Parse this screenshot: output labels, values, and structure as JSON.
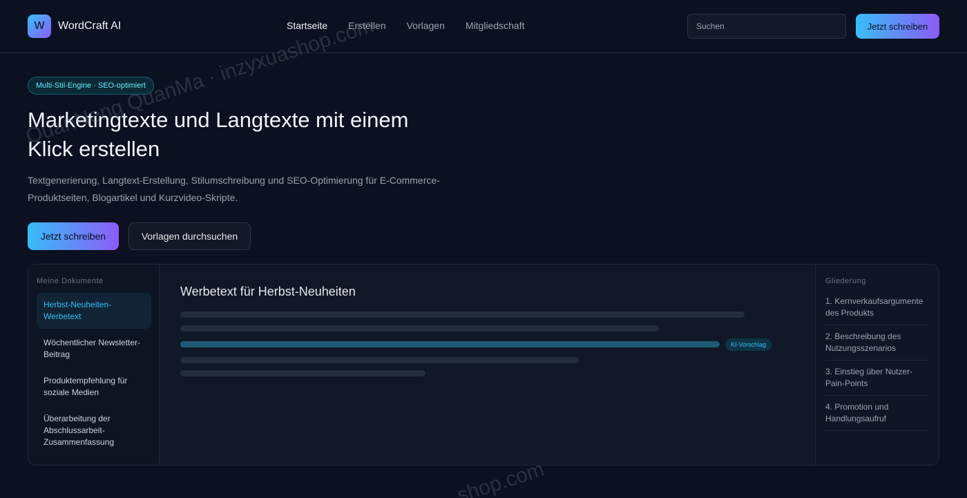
{
  "header": {
    "logo_letter": "W",
    "brand": "WordCraft AI",
    "nav": [
      "Startseite",
      "Erstellen",
      "Vorlagen",
      "Mitgliedschaft"
    ],
    "active_nav": "Startseite",
    "search_placeholder": "Suchen",
    "cta_label": "Jetzt schreiben"
  },
  "hero": {
    "badge": "Multi-Stil-Engine · SEO-optimiert",
    "title": "Marketingtexte und Langtexte mit einem Klick erstellen",
    "subtitle": "Textgenerierung, Langtext-Erstellung, Stilumschreibung und SEO-Optimierung für E-Commerce-Produktseiten, Blogartikel und Kurzvideo-Skripte.",
    "primary_button": "Jetzt schreiben",
    "secondary_button": "Vorlagen durchsuchen"
  },
  "documents": {
    "title": "Meine Dokumente",
    "items": [
      "Herbst-Neuheiten-Werbetext",
      "Wöchentlicher Newsletter-Beitrag",
      "Produktempfehlung für soziale Medien",
      "Überarbeitung der Abschlussarbeit-Zusammenfassung"
    ],
    "active_index": 0
  },
  "editor": {
    "heading": "Werbetext für Herbst-Neuheiten",
    "ai_chip": "KI-Vorschlag"
  },
  "outline": {
    "title": "Gliederung",
    "items": [
      "1. Kernverkaufsargumente des Produkts",
      "2. Beschreibung des Nutzungsszenarios",
      "3. Einstieg über Nutzer-Pain-Points",
      "4. Promotion und Handlungsaufruf"
    ]
  },
  "watermarks": {
    "top": "QuanNeng QuanMa · inzyxuashop.com",
    "bottom": "shop.com"
  },
  "colors": {
    "background": "#0b1120",
    "accent_start": "#38bdf8",
    "accent_end": "#8b5cf6",
    "highlight": "#1e5a74"
  }
}
